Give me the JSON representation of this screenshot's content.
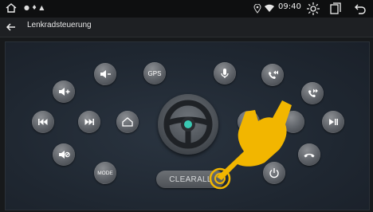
{
  "status": {
    "time": "09:40",
    "icons": [
      "home-icon",
      "notification-icons",
      "location-icon",
      "wifi-icon",
      "brightness-icon",
      "window-icon",
      "back-icon"
    ]
  },
  "header": {
    "title": "Lenkradsteuerung"
  },
  "buttons": {
    "gps_label": "GPS",
    "mode_label": "MODE",
    "clearall_label": "CLEARALL"
  },
  "accent": {
    "wheel_center": "#39c9b3",
    "hand": "#f2b600"
  }
}
